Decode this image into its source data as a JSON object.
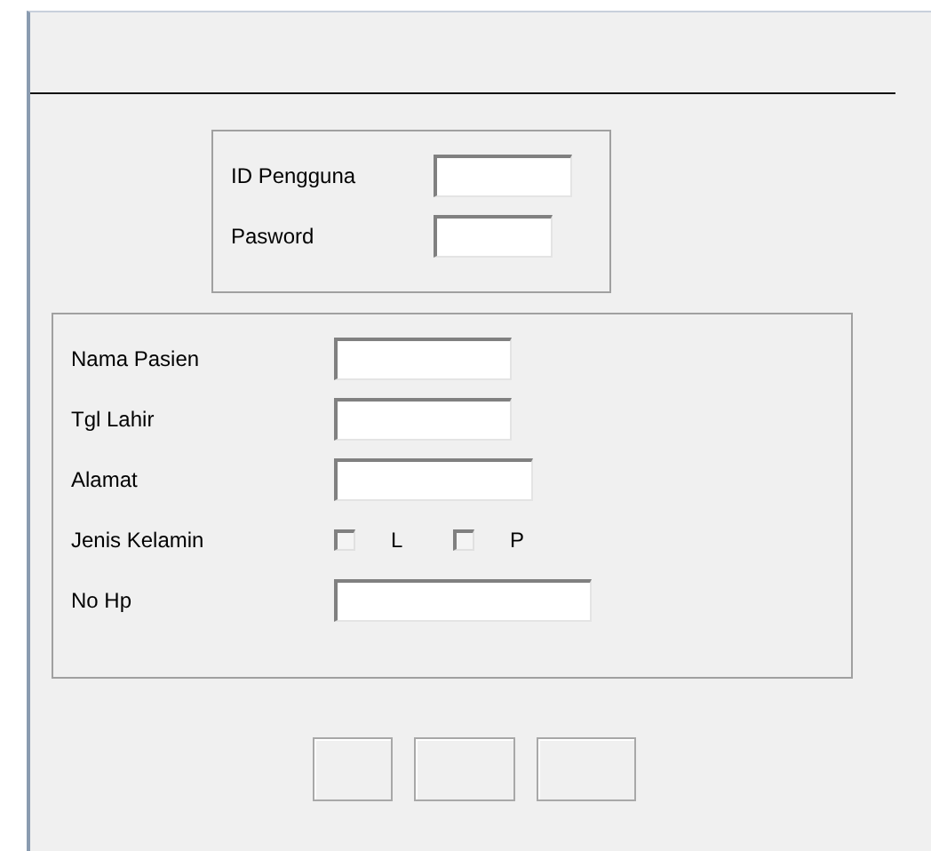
{
  "login": {
    "fields": [
      {
        "label": "ID Pengguna",
        "kind": "text"
      },
      {
        "label": "Pasword",
        "kind": "text"
      }
    ]
  },
  "patient": {
    "fields": [
      {
        "label": "Nama Pasien",
        "kind": "text"
      },
      {
        "label": "Tgl Lahir",
        "kind": "text"
      },
      {
        "label": "Alamat",
        "kind": "text"
      },
      {
        "label": "Jenis Kelamin",
        "kind": "checks",
        "options": [
          {
            "label": "L",
            "checked": false
          },
          {
            "label": "P",
            "checked": false
          }
        ]
      },
      {
        "label": "No Hp",
        "kind": "text"
      }
    ]
  },
  "buttons": [
    {
      "kind": "blank"
    },
    {
      "kind": "blank"
    },
    {
      "kind": "blank"
    }
  ]
}
